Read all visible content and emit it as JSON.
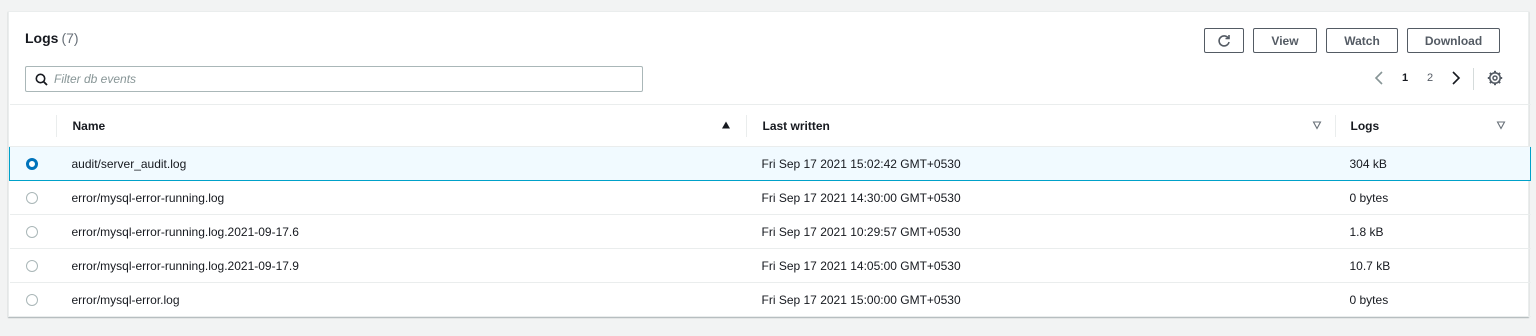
{
  "header": {
    "title": "Logs",
    "count": "(7)",
    "search_placeholder": "Filter db events",
    "buttons": {
      "refresh_icon": "refresh-icon",
      "view": "View",
      "watch": "Watch",
      "download": "Download"
    }
  },
  "pagination": {
    "pages": [
      "1",
      "2"
    ],
    "current": "1"
  },
  "table": {
    "columns": [
      "Name",
      "Last written",
      "Logs"
    ],
    "rows": [
      {
        "name": "audit/server_audit.log",
        "last_written": "Fri Sep 17 2021 15:02:42 GMT+0530",
        "logs": "304 kB",
        "selected": true
      },
      {
        "name": "error/mysql-error-running.log",
        "last_written": "Fri Sep 17 2021 14:30:00 GMT+0530",
        "logs": "0 bytes",
        "selected": false
      },
      {
        "name": "error/mysql-error-running.log.2021-09-17.6",
        "last_written": "Fri Sep 17 2021 10:29:57 GMT+0530",
        "logs": "1.8 kB",
        "selected": false
      },
      {
        "name": "error/mysql-error-running.log.2021-09-17.9",
        "last_written": "Fri Sep 17 2021 14:05:00 GMT+0530",
        "logs": "10.7 kB",
        "selected": false
      },
      {
        "name": "error/mysql-error.log",
        "last_written": "Fri Sep 17 2021 15:00:00 GMT+0530",
        "logs": "0 bytes",
        "selected": false
      }
    ]
  },
  "colors": {
    "accent": "#0073bb",
    "selected_border": "#00a1c9",
    "selected_bg": "#f1faff"
  }
}
